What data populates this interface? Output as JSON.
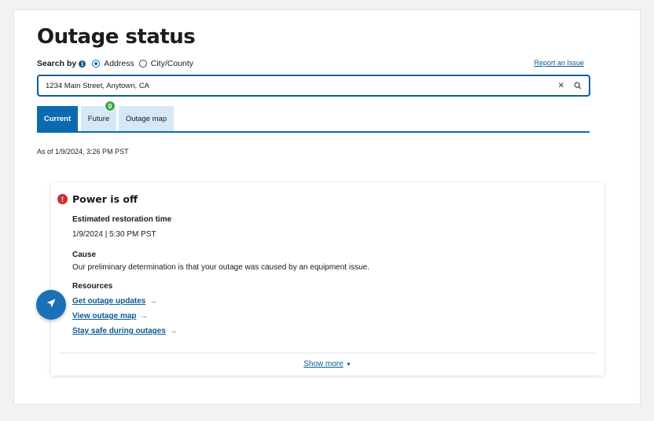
{
  "page": {
    "title": "Outage status"
  },
  "search": {
    "by_label": "Search by",
    "options": [
      {
        "label": "Address",
        "selected": true
      },
      {
        "label": "City/County",
        "selected": false
      }
    ],
    "value": "1234 Main Street, Anytown, CA",
    "report_link": "Report an Issue"
  },
  "tabs": [
    {
      "label": "Current",
      "active": true
    },
    {
      "label": "Future",
      "active": false,
      "badge": "0"
    },
    {
      "label": "Outage map",
      "active": false
    }
  ],
  "as_of": "As of 1/9/2024, 3:26 PM PST",
  "status": {
    "title": "Power is off",
    "restoration_label": "Estimated restoration time",
    "restoration_value": "1/9/2024 | 5:30 PM PST",
    "cause_label": "Cause",
    "cause_value": "Our preliminary determination is that your outage was caused by an equipment issue.",
    "resources_label": "Resources",
    "resources": [
      "Get outage updates",
      "View outage map",
      "Stay safe during outages"
    ],
    "show_more": "Show more"
  },
  "icons": {
    "info": "info-icon",
    "clear": "close-icon",
    "search": "search-icon",
    "alert": "alert-icon",
    "arrow": "arrow-right-icon",
    "caret": "caret-down-icon",
    "fab": "navigation-arrow-icon"
  },
  "colors": {
    "primary": "#0a6bb0",
    "link": "#0a5a8e",
    "tab_inactive": "#d6e8f5",
    "badge": "#3aa84a",
    "alert": "#d22b2b"
  }
}
